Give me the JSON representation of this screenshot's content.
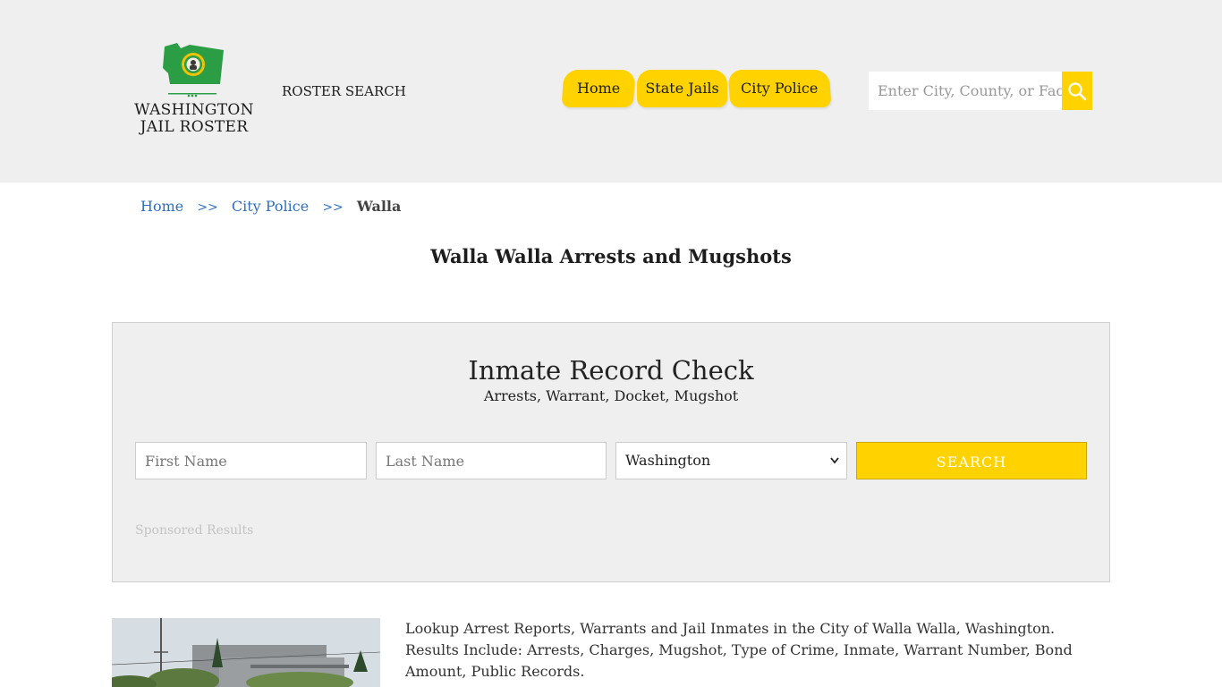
{
  "header": {
    "logo_line1": "WASHINGTON",
    "logo_line2": "JAIL ROSTER",
    "roster_search": "ROSTER SEARCH",
    "nav": [
      {
        "label": "Home"
      },
      {
        "label": "State Jails"
      },
      {
        "label": "City Police"
      }
    ],
    "search_placeholder": "Enter City, County, or Facility",
    "search_visible_text": "Enter City, County, or Facil"
  },
  "breadcrumb": {
    "items": [
      "Home",
      "City Police"
    ],
    "separator": ">>",
    "current": "Walla"
  },
  "page_title": "Walla Walla Arrests and Mugshots",
  "record_check": {
    "title": "Inmate Record Check",
    "subtitle": "Arrests, Warrant, Docket, Mugshot",
    "first_name_placeholder": "First Name",
    "last_name_placeholder": "Last Name",
    "state_selected": "Washington",
    "search_label": "SEARCH",
    "sponsored": "Sponsored Results"
  },
  "description": "Lookup Arrest Reports, Warrants and Jail Inmates in the City of Walla Walla, Washington. Results Include: Arrests, Charges, Mugshot, Type of Crime, Inmate, Warrant Number, Bond Amount, Public Records.",
  "colors": {
    "accent": "#ffd200",
    "link": "#2f6ec1",
    "header_bg": "#efefef",
    "logo_green": "#2a9d45"
  }
}
